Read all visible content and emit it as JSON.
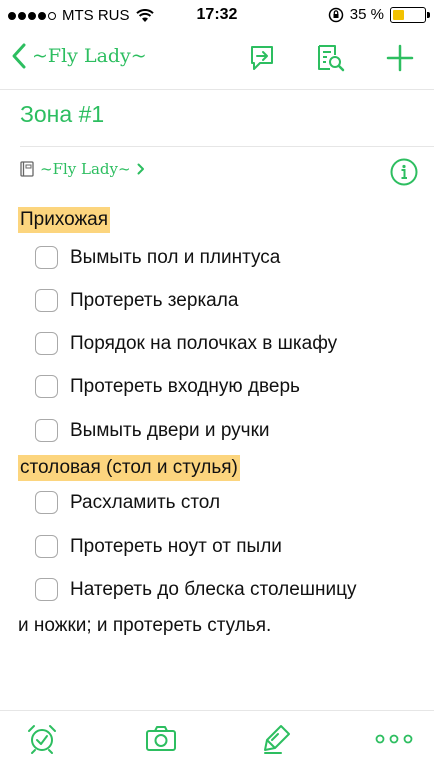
{
  "status_bar": {
    "carrier": "MTS RUS",
    "time": "17:32",
    "battery_percent_label": "35 %",
    "battery_level": 0.35,
    "signal_icon": "signal-dots-icon",
    "wifi_icon": "wifi-icon",
    "rotation_lock_icon": "rotation-lock-icon"
  },
  "nav": {
    "back_label": "~Fly Lady~",
    "icons": [
      "share-chat-icon",
      "search-note-icon",
      "plus-icon"
    ]
  },
  "note": {
    "title": "Зона #1",
    "notebook": "~Fly Lady~",
    "sections": [
      {
        "heading": "Прихожая",
        "items": [
          "Вымыть пол и плинтуса",
          "Протереть зеркала",
          "Порядок на полочках в шкафу",
          "Протереть входную дверь",
          "Вымыть двери и ручки"
        ]
      },
      {
        "heading": "столовая (стол и стулья)",
        "items": [
          "Расхламить стол",
          "Протереть ноут от пыли",
          "Натереть до блеска столешницу"
        ],
        "continuation": "и ножки; и протереть стулья."
      }
    ]
  },
  "toolbar": {
    "icons": [
      "alarm-clock-icon",
      "camera-icon",
      "pen-icon",
      "more-icon"
    ]
  },
  "colors": {
    "accent": "#2dbe60",
    "highlight": "#fcd57e",
    "battery_fill": "#f2c200"
  }
}
